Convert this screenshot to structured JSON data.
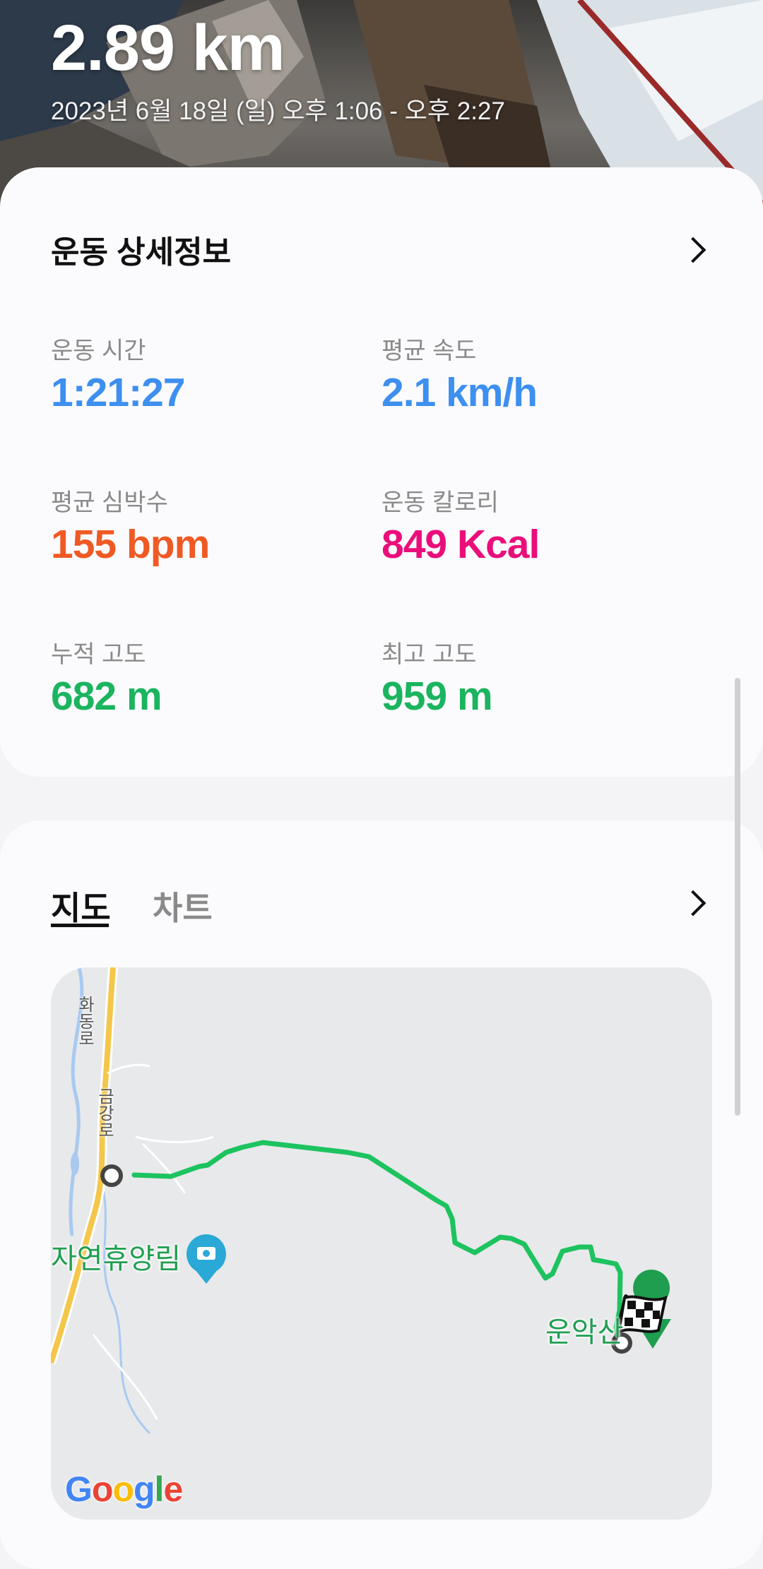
{
  "hero": {
    "distance": "2.89 km",
    "date_range": "2023년 6월 18일 (일) 오후 1:06 - 오후 2:27"
  },
  "details": {
    "title": "운동 상세정보",
    "stats": [
      {
        "label": "운동 시간",
        "value": "1:21:27",
        "color": "#3d8ff0"
      },
      {
        "label": "평균 속도",
        "value": "2.1 km/h",
        "color": "#3d8ff0"
      },
      {
        "label": "평균 심박수",
        "value": "155 bpm",
        "color": "#ef5a24"
      },
      {
        "label": "운동 칼로리",
        "value": "849 Kcal",
        "color": "#ea0e7a"
      },
      {
        "label": "누적 고도",
        "value": "682 m",
        "color": "#1bb45f"
      },
      {
        "label": "최고 고도",
        "value": "959 m",
        "color": "#1bb45f"
      }
    ]
  },
  "map_section": {
    "tabs": [
      {
        "label": "지도",
        "selected": true
      },
      {
        "label": "차트",
        "selected": false
      }
    ],
    "labels": {
      "road_1": "화동로",
      "road_2": "금강로",
      "place_forest": "자연휴양림",
      "place_peak": "운악산"
    },
    "provider": "Google",
    "route_color": "#1cc35f"
  }
}
